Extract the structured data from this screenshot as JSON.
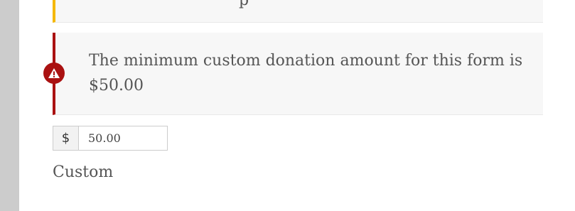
{
  "warning_notice": {
    "partial_text": "p"
  },
  "error_notice": {
    "message": "The minimum custom donation amount for this form is $50.00",
    "icon": "warning-triangle-icon",
    "accent_color": "#aa1111"
  },
  "amount_field": {
    "currency_symbol": "$",
    "value": "50.00"
  },
  "level_label": "Custom",
  "colors": {
    "warning_accent": "#f5b800",
    "notice_background": "#f7f7f7",
    "gutter": "#cccccc"
  }
}
